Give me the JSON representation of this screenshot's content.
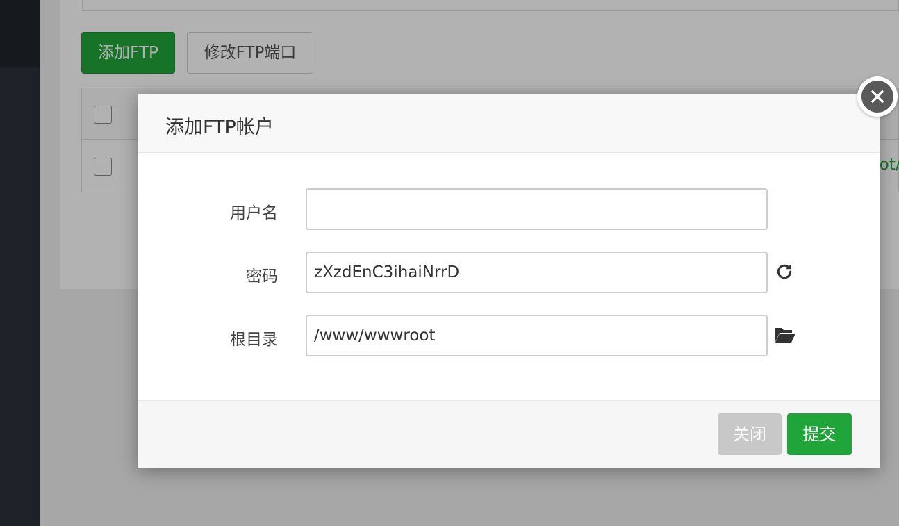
{
  "background": {
    "add_ftp_button": "添加FTP",
    "modify_port_button": "修改FTP端口",
    "table_row_path_fragment": "ot/l"
  },
  "dialog": {
    "title": "添加FTP帐户",
    "fields": {
      "username": {
        "label": "用户名",
        "value": ""
      },
      "password": {
        "label": "密码",
        "value": "zXzdEnC3ihaiNrrD"
      },
      "root_dir": {
        "label": "根目录",
        "value": "/www/wwwroot"
      }
    },
    "buttons": {
      "close": "关闭",
      "submit": "提交"
    }
  },
  "icons": {
    "close": "close-icon",
    "refresh": "refresh-icon",
    "folder": "folder-open-icon"
  },
  "colors": {
    "accent": "#20a53a",
    "sidebar": "#2a313a",
    "disabled": "#c8c8c8"
  }
}
